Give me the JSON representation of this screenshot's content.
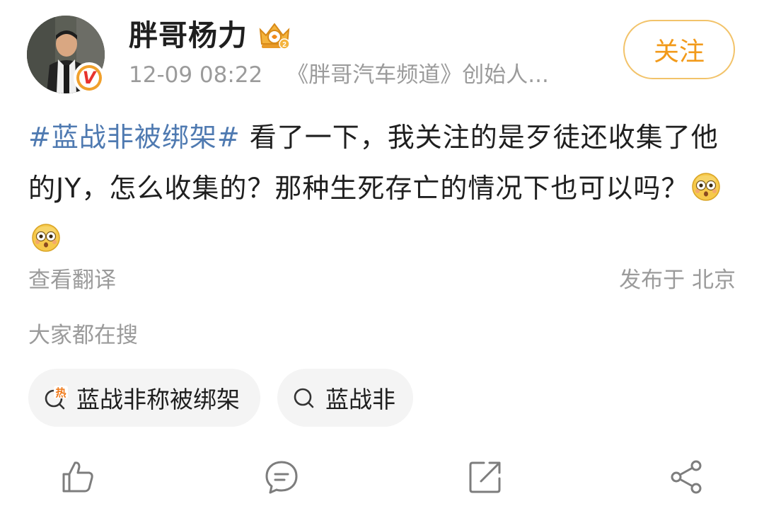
{
  "header": {
    "username": "胖哥杨力",
    "timestamp": "12-09 08:22",
    "source": "《胖哥汽车频道》创始人...",
    "follow_label": "关注",
    "badge_icon": "crown-badge-icon",
    "verified_icon": "verified-v-icon"
  },
  "post": {
    "hashtag": "#蓝战非被绑架#",
    "text": " 看了一下，我关注的是歹徒还收集了他的JY，怎么收集的？那种生死存亡的情况下也可以吗？",
    "emoji": [
      "flushed-face-emoji",
      "flushed-face-emoji"
    ],
    "translate_label": "查看翻译",
    "location_label": "发布于 北京"
  },
  "trending": {
    "heading": "大家都在搜",
    "chips": [
      {
        "label": "蓝战非称被绑架",
        "icon": "hot-search-icon",
        "hot_badge": "热"
      },
      {
        "label": "蓝战非",
        "icon": "search-icon"
      }
    ]
  },
  "actions": [
    {
      "name": "like",
      "icon": "thumbs-up-icon"
    },
    {
      "name": "comment",
      "icon": "comment-icon"
    },
    {
      "name": "repost",
      "icon": "repost-icon"
    },
    {
      "name": "share",
      "icon": "share-icon"
    }
  ],
  "colors": {
    "hashtag": "#4f7ab1",
    "follow_text": "#f29a1a",
    "follow_border": "#f2c36a",
    "muted_text": "#9b9b9b",
    "chip_bg": "#f4f4f4",
    "hot_badge": "#f07a1a"
  }
}
